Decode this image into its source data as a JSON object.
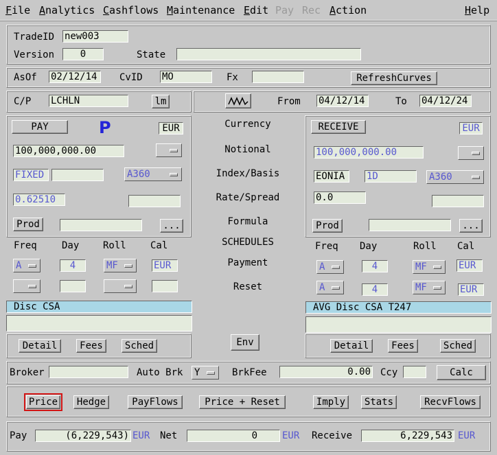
{
  "menu": [
    {
      "label": "File",
      "ul": "F",
      "rest": "ile",
      "enabled": true
    },
    {
      "label": "Analytics",
      "ul": "A",
      "rest": "nalytics",
      "enabled": true
    },
    {
      "label": "Cashflows",
      "ul": "C",
      "rest": "ashflows",
      "enabled": true
    },
    {
      "label": "Maintenance",
      "ul": "M",
      "rest": "aintenance",
      "enabled": true
    },
    {
      "label": "Edit",
      "ul": "E",
      "rest": "dit",
      "enabled": true
    },
    {
      "label": "Pay",
      "ul": "",
      "rest": "Pay",
      "enabled": false
    },
    {
      "label": "Rec",
      "ul": "",
      "rest": "Rec",
      "enabled": false
    },
    {
      "label": "Action",
      "ul": "A",
      "rest": "ction",
      "enabled": true
    },
    {
      "label": "Help",
      "ul": "H",
      "rest": "elp",
      "enabled": true
    }
  ],
  "trade": {
    "tradeid_label": "TradeID",
    "tradeid": "new003",
    "version_label": "Version",
    "version": "0",
    "state_label": "State",
    "state": ""
  },
  "asof": {
    "asof_label": "AsOf",
    "asof": "02/12/14",
    "cvid_label": "CvID",
    "cvid": "MO",
    "fx_label": "Fx",
    "fx": "",
    "refresh_label": "RefreshCurves"
  },
  "cp": {
    "cp_label": "C/P",
    "cp": "LCHLN",
    "lm_label": "lm",
    "from_label": "From",
    "from": "04/12/14",
    "to_label": "To",
    "to": "04/12/24"
  },
  "center": {
    "currency": "Currency",
    "notional": "Notional",
    "index_basis": "Index/Basis",
    "rate_spread": "Rate/Spread",
    "formula": "Formula",
    "schedules": "SCHEDULES",
    "payment": "Payment",
    "reset": "Reset",
    "env": "Env"
  },
  "pay": {
    "button": "PAY",
    "marker": "P",
    "currency": "EUR",
    "notional": "100,000,000.00",
    "rate_type": "FIXED",
    "rate_extra": "",
    "daycount": "A360",
    "rate": "0.62510",
    "spread": "",
    "prod_label": "Prod",
    "prod": "",
    "more_label": "...",
    "freq_label": "Freq",
    "day_label": "Day",
    "roll_label": "Roll",
    "cal_label": "Cal",
    "pay_freq": "A",
    "pay_day": "4",
    "pay_roll": "MF",
    "pay_cal": "EUR",
    "reset_freq": "",
    "reset_day": "",
    "reset_roll": "",
    "reset_cal": "",
    "disc": "Disc CSA",
    "disc_extra": "",
    "detail": "Detail",
    "fees": "Fees",
    "sched": "Sched"
  },
  "receive": {
    "button": "RECEIVE",
    "currency": "EUR",
    "notional": "100,000,000.00",
    "index": "EONIA",
    "tenor": "1D",
    "daycount": "A360",
    "spread": "0.0",
    "extra": "",
    "prod_label": "Prod",
    "prod": "",
    "more_label": "...",
    "freq_label": "Freq",
    "day_label": "Day",
    "roll_label": "Roll",
    "cal_label": "Cal",
    "pay_freq": "A",
    "pay_day": "4",
    "pay_roll": "MF",
    "pay_cal": "EUR",
    "reset_freq": "A",
    "reset_day": "4",
    "reset_roll": "MF",
    "reset_cal": "EUR",
    "disc": "AVG Disc CSA T247",
    "disc_extra": "",
    "detail": "Detail",
    "fees": "Fees",
    "sched": "Sched"
  },
  "broker": {
    "broker_label": "Broker",
    "broker": "",
    "autobrk_label": "Auto Brk",
    "autobrk": "Y",
    "brkfee_label": "BrkFee",
    "brkfee": "0.00",
    "ccy_label": "Ccy",
    "ccy": "",
    "calc": "Calc"
  },
  "actions": [
    "Price",
    "Hedge",
    "PayFlows",
    "Price + Reset",
    "Imply",
    "Stats",
    "RecvFlows"
  ],
  "totals": {
    "pay_label": "Pay",
    "pay": "(6,229,543)",
    "pay_ccy": "EUR",
    "net_label": "Net",
    "net": "0",
    "net_ccy": "EUR",
    "receive_label": "Receive",
    "receive": "6,229,543",
    "receive_ccy": "EUR"
  },
  "colors": {
    "field_bg": "#e4ebdd",
    "disc_bg": "#a9d7e6",
    "accent_blue": "#5757d0",
    "marker_blue": "#2525d8",
    "selected_outline": "#d21414"
  }
}
